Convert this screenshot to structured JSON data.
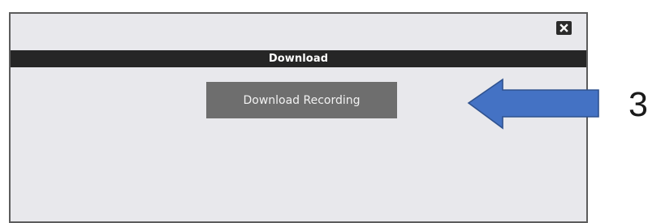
{
  "dialog": {
    "title": "Download",
    "close_icon": "close-icon",
    "download_button_label": "Download Recording"
  },
  "annotation": {
    "step_number": "3",
    "arrow_icon": "arrow-left-icon",
    "arrow_color": "#4472c4",
    "arrow_stroke_color": "#2f528f"
  },
  "colors": {
    "title_bar": "#262626",
    "dialog_background": "#e8e8ec",
    "button_background": "#6e6e6e"
  }
}
